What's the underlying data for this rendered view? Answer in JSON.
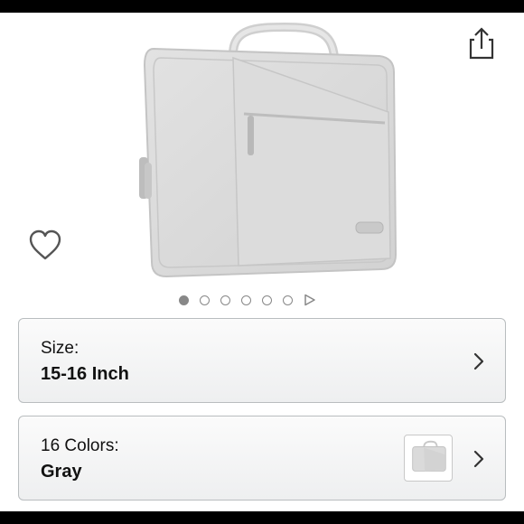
{
  "product": {
    "image": "gray laptop sleeve briefcase with handle, front zipper pocket and side zipper",
    "share_icon": "share-icon",
    "wishlist_icon": "heart-outline-icon"
  },
  "gallery": {
    "image_count": 6,
    "active_index": 0,
    "has_video": true
  },
  "size_option": {
    "label": "Size:",
    "value": "15-16 Inch"
  },
  "color_option": {
    "label": "16 Colors:",
    "value": "Gray"
  },
  "colors": {
    "bag": "#dadada",
    "card_border": "#b9bdbf",
    "text": "#111111"
  }
}
